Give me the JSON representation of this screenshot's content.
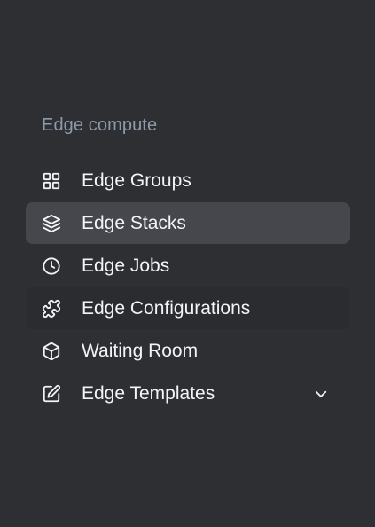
{
  "section": {
    "title": "Edge compute"
  },
  "nav": {
    "items": [
      {
        "label": "Edge Groups",
        "icon": "grid-icon",
        "state": "default"
      },
      {
        "label": "Edge Stacks",
        "icon": "layers-icon",
        "state": "active"
      },
      {
        "label": "Edge Jobs",
        "icon": "clock-icon",
        "state": "default"
      },
      {
        "label": "Edge Configurations",
        "icon": "puzzle-icon",
        "state": "hovered"
      },
      {
        "label": "Waiting Room",
        "icon": "box-icon",
        "state": "default"
      },
      {
        "label": "Edge Templates",
        "icon": "edit-icon",
        "state": "default",
        "expandable": true,
        "expand_icon": "chevron-down-icon"
      }
    ]
  },
  "colors": {
    "background": "#2e2f33",
    "active_background": "#46474c",
    "hover_background": "#2b2c30",
    "section_title": "#8d9aab",
    "label": "#f3f4f6"
  }
}
